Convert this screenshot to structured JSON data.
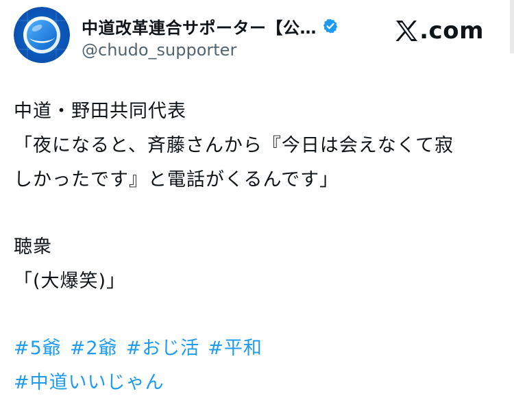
{
  "account": {
    "display_name": "中道改革連合サポーター【公…",
    "handle": "@chudo_supporter",
    "verified_icon": "verified-badge-icon",
    "avatar_icon": "blue-sphere-logo"
  },
  "site": {
    "label": ".com",
    "icon": "x-logo-icon"
  },
  "post": {
    "lines": [
      "中道・野田共同代表",
      "「夜になると、斉藤さんから『今日は会えなくて寂",
      "しかったです』と電話がくるんです」"
    ],
    "lines2": [
      "聴衆",
      "「(大爆笑)」"
    ],
    "hashtags_row1": [
      "#5爺",
      "#2爺",
      "#おじ活",
      "#平和"
    ],
    "hashtags_row2": [
      "#中道いいじゃん"
    ]
  },
  "colors": {
    "accent": "#1d9bf0",
    "text": "#0f1419",
    "secondary": "#536471"
  }
}
